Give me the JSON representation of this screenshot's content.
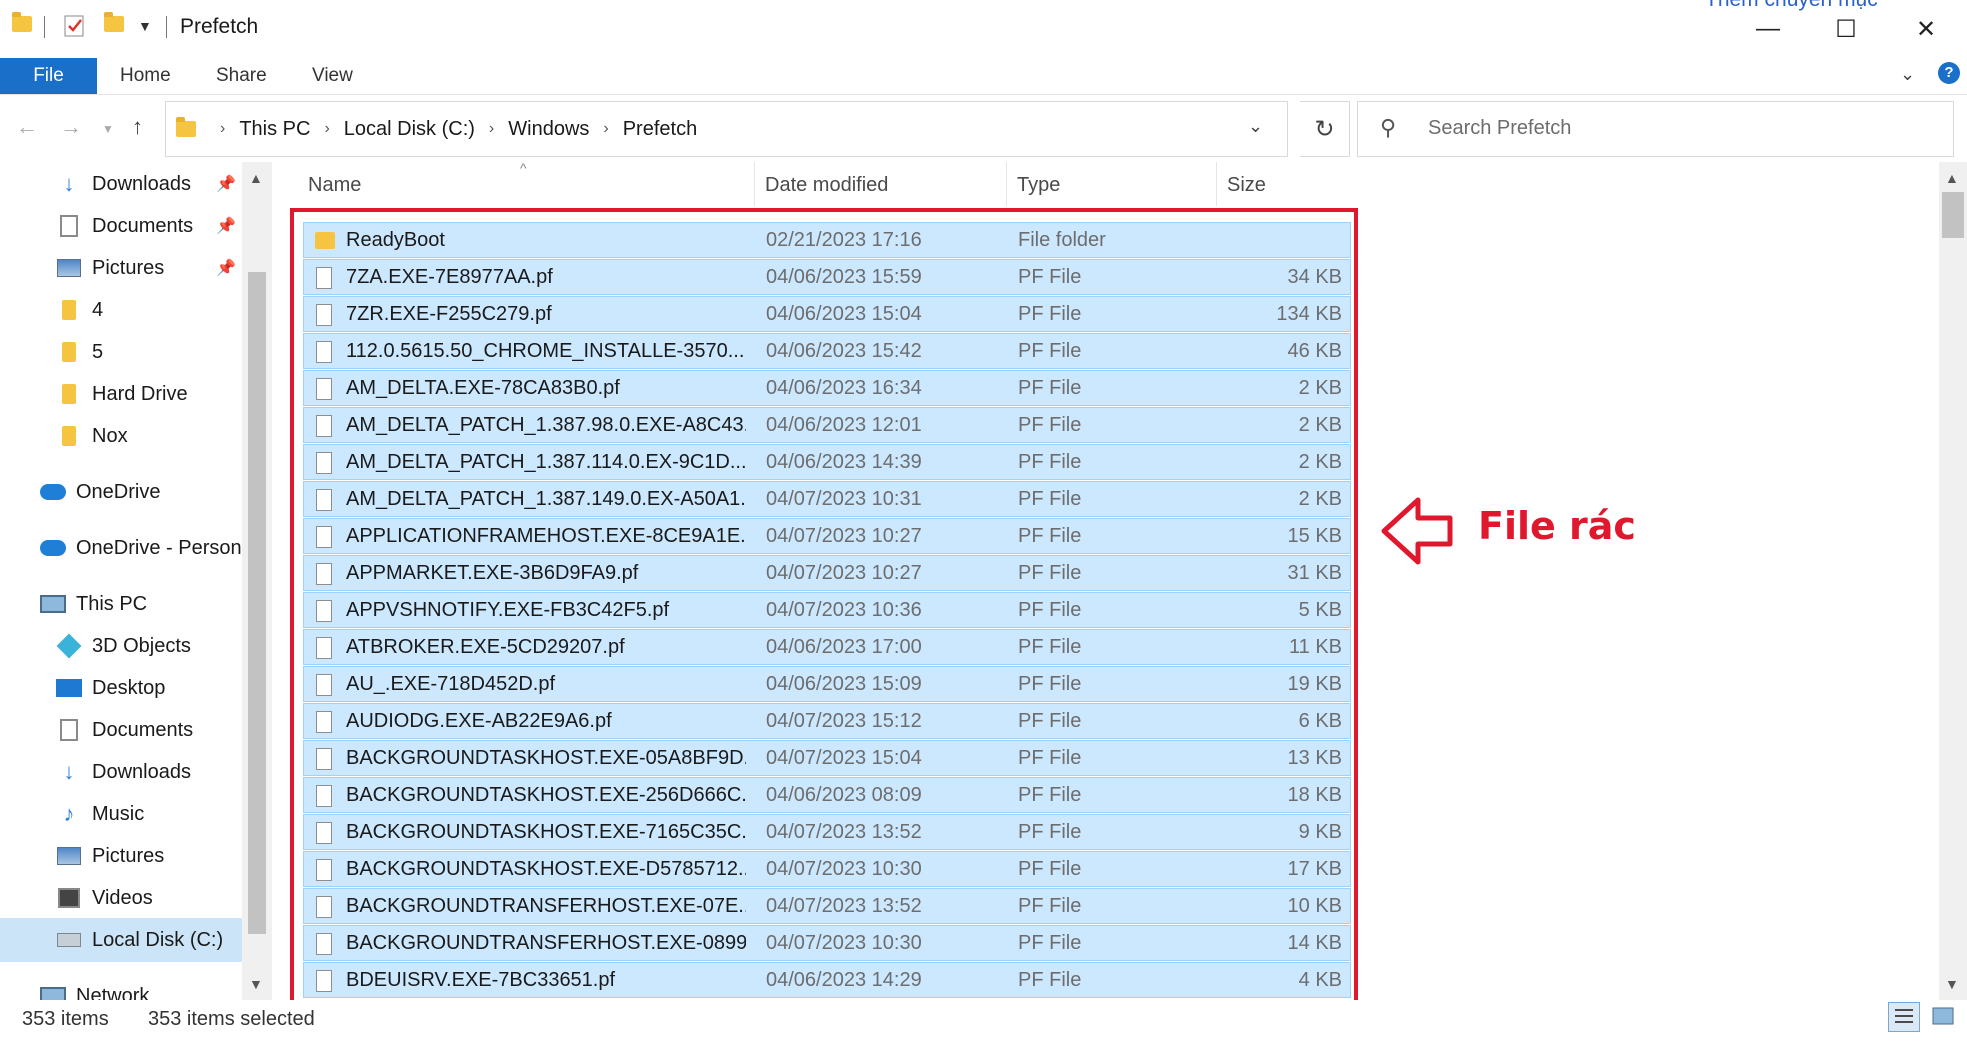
{
  "window": {
    "title": "Prefetch",
    "partial_top_text": "Thêm chuyên mục",
    "minimize_glyph": "—",
    "maximize_glyph": "☐",
    "close_glyph": "✕"
  },
  "ribbon": {
    "tabs": [
      "File",
      "Home",
      "Share",
      "View"
    ],
    "expand_glyph": "⌄",
    "help_glyph": "?"
  },
  "address": {
    "crumbs": [
      "This PC",
      "Local Disk (C:)",
      "Windows",
      "Prefetch"
    ],
    "separator": "›",
    "search_placeholder": "Search Prefetch"
  },
  "nav": {
    "items": [
      {
        "label": "Downloads",
        "icon": "download-arrow-icon",
        "pinned": true
      },
      {
        "label": "Documents",
        "icon": "document-icon",
        "pinned": true
      },
      {
        "label": "Pictures",
        "icon": "pictures-icon",
        "pinned": true
      },
      {
        "label": "4",
        "icon": "folder-icon",
        "pinned": false
      },
      {
        "label": "5",
        "icon": "folder-icon",
        "pinned": false
      },
      {
        "label": "Hard Drive",
        "icon": "folder-icon",
        "pinned": false
      },
      {
        "label": "Nox",
        "icon": "folder-icon",
        "pinned": false
      },
      {
        "label": "OneDrive",
        "icon": "cloud-icon",
        "pinned": false
      },
      {
        "label": "OneDrive - Person",
        "icon": "cloud-icon",
        "pinned": false
      },
      {
        "label": "This PC",
        "icon": "computer-icon",
        "pinned": false
      },
      {
        "label": "3D Objects",
        "icon": "cube-icon",
        "pinned": false
      },
      {
        "label": "Desktop",
        "icon": "desktop-icon",
        "pinned": false
      },
      {
        "label": "Documents",
        "icon": "document-icon",
        "pinned": false
      },
      {
        "label": "Downloads",
        "icon": "download-arrow-icon",
        "pinned": false
      },
      {
        "label": "Music",
        "icon": "music-note-icon",
        "pinned": false
      },
      {
        "label": "Pictures",
        "icon": "pictures-icon",
        "pinned": false
      },
      {
        "label": "Videos",
        "icon": "video-icon",
        "pinned": false
      },
      {
        "label": "Local Disk (C:)",
        "icon": "drive-icon",
        "pinned": false,
        "selected": true
      },
      {
        "label": "Network",
        "icon": "network-icon",
        "pinned": false
      }
    ]
  },
  "columns": {
    "name": "Name",
    "date": "Date modified",
    "type": "Type",
    "size": "Size"
  },
  "files": [
    {
      "name": "ReadyBoot",
      "date": "02/21/2023 17:16",
      "type": "File folder",
      "size": "",
      "folder": true
    },
    {
      "name": "7ZA.EXE-7E8977AA.pf",
      "date": "04/06/2023 15:59",
      "type": "PF File",
      "size": "34 KB"
    },
    {
      "name": "7ZR.EXE-F255C279.pf",
      "date": "04/06/2023 15:04",
      "type": "PF File",
      "size": "134 KB"
    },
    {
      "name": "112.0.5615.50_CHROME_INSTALLE-3570...",
      "date": "04/06/2023 15:42",
      "type": "PF File",
      "size": "46 KB"
    },
    {
      "name": "AM_DELTA.EXE-78CA83B0.pf",
      "date": "04/06/2023 16:34",
      "type": "PF File",
      "size": "2 KB"
    },
    {
      "name": "AM_DELTA_PATCH_1.387.98.0.EXE-A8C43...",
      "date": "04/06/2023 12:01",
      "type": "PF File",
      "size": "2 KB"
    },
    {
      "name": "AM_DELTA_PATCH_1.387.114.0.EX-9C1D...",
      "date": "04/06/2023 14:39",
      "type": "PF File",
      "size": "2 KB"
    },
    {
      "name": "AM_DELTA_PATCH_1.387.149.0.EX-A50A1...",
      "date": "04/07/2023 10:31",
      "type": "PF File",
      "size": "2 KB"
    },
    {
      "name": "APPLICATIONFRAMEHOST.EXE-8CE9A1E...",
      "date": "04/07/2023 10:27",
      "type": "PF File",
      "size": "15 KB"
    },
    {
      "name": "APPMARKET.EXE-3B6D9FA9.pf",
      "date": "04/07/2023 10:27",
      "type": "PF File",
      "size": "31 KB"
    },
    {
      "name": "APPVSHNOTIFY.EXE-FB3C42F5.pf",
      "date": "04/07/2023 10:36",
      "type": "PF File",
      "size": "5 KB"
    },
    {
      "name": "ATBROKER.EXE-5CD29207.pf",
      "date": "04/06/2023 17:00",
      "type": "PF File",
      "size": "11 KB"
    },
    {
      "name": "AU_.EXE-718D452D.pf",
      "date": "04/06/2023 15:09",
      "type": "PF File",
      "size": "19 KB"
    },
    {
      "name": "AUDIODG.EXE-AB22E9A6.pf",
      "date": "04/07/2023 15:12",
      "type": "PF File",
      "size": "6 KB"
    },
    {
      "name": "BACKGROUNDTASKHOST.EXE-05A8BF9D...",
      "date": "04/07/2023 15:04",
      "type": "PF File",
      "size": "13 KB"
    },
    {
      "name": "BACKGROUNDTASKHOST.EXE-256D666C...",
      "date": "04/06/2023 08:09",
      "type": "PF File",
      "size": "18 KB"
    },
    {
      "name": "BACKGROUNDTASKHOST.EXE-7165C35C...",
      "date": "04/07/2023 13:52",
      "type": "PF File",
      "size": "9 KB"
    },
    {
      "name": "BACKGROUNDTASKHOST.EXE-D5785712...",
      "date": "04/07/2023 10:30",
      "type": "PF File",
      "size": "17 KB"
    },
    {
      "name": "BACKGROUNDTRANSFERHOST.EXE-07E...",
      "date": "04/07/2023 13:52",
      "type": "PF File",
      "size": "10 KB"
    },
    {
      "name": "BACKGROUNDTRANSFERHOST.EXE-0899...",
      "date": "04/07/2023 10:30",
      "type": "PF File",
      "size": "14 KB"
    },
    {
      "name": "BDEUISRV.EXE-7BC33651.pf",
      "date": "04/06/2023 14:29",
      "type": "PF File",
      "size": "4 KB"
    }
  ],
  "annotation": {
    "label": "File rác",
    "color": "#e0182d"
  },
  "status": {
    "items_count": "353 items",
    "selected_count": "353 items selected"
  },
  "colors": {
    "selection": "#cce8ff",
    "selection_border": "#99d1ff",
    "accent": "#1a6fc9"
  }
}
